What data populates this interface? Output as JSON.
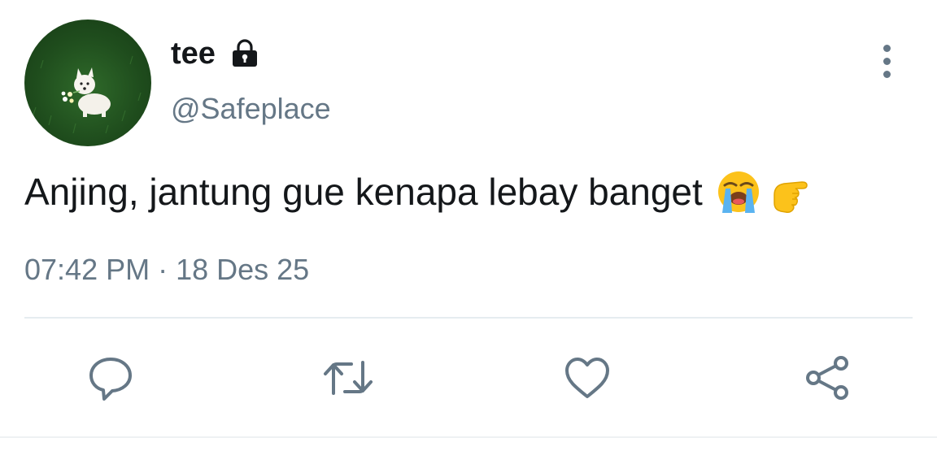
{
  "tweet": {
    "display_name": "tee",
    "handle": "@Safeplace",
    "text": "Anjing, jantung gue kenapa lebay banget",
    "emojis": [
      "loudly-crying-face",
      "backhand-index-pointing-right"
    ],
    "time": "07:42 PM",
    "separator": " · ",
    "date": "18 Des 25",
    "protected": true
  },
  "icons": {
    "lock": "lock-icon",
    "more": "more-vertical-icon",
    "reply": "reply-icon",
    "retweet": "retweet-icon",
    "like": "heart-icon",
    "share": "share-icon"
  },
  "colors": {
    "primary_text": "#14171a",
    "secondary_text": "#657786",
    "divider": "#e6ecf0"
  }
}
